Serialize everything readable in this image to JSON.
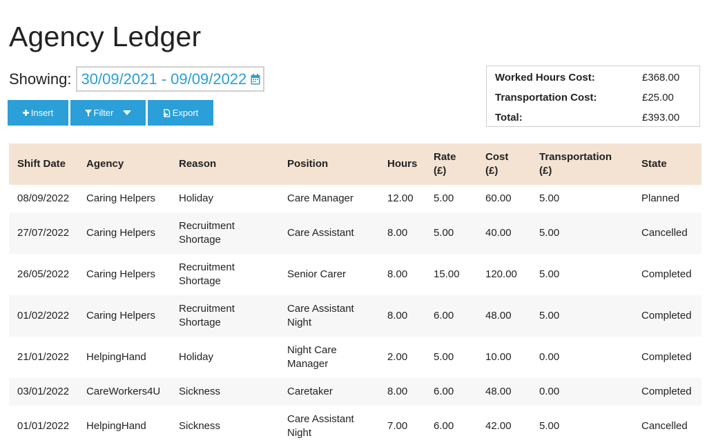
{
  "page": {
    "title": "Agency Ledger",
    "showing_label": "Showing:",
    "date_range": "30/09/2021 - 09/09/2022"
  },
  "toolbar": {
    "insert_label": "Insert",
    "filter_label": "Filter",
    "export_label": "Export"
  },
  "summary": {
    "worked_hours_label": "Worked Hours Cost:",
    "worked_hours_value": "£368.00",
    "transport_label": "Transportation Cost:",
    "transport_value": "£25.00",
    "total_label": "Total:",
    "total_value": "£393.00"
  },
  "table": {
    "headers": {
      "shift_date": "Shift Date",
      "agency": "Agency",
      "reason": "Reason",
      "position": "Position",
      "hours": "Hours",
      "rate_1": "Rate",
      "rate_2": "(£)",
      "cost_1": "Cost",
      "cost_2": "(£)",
      "transport_1": "Transportation",
      "transport_2": "(£)",
      "state": "State"
    },
    "rows": [
      {
        "date": "08/09/2022",
        "agency": "Caring Helpers",
        "reason_1": "Holiday",
        "reason_2": "",
        "position_1": "Care Manager",
        "position_2": "",
        "hours": "12.00",
        "rate": "5.00",
        "cost": "60.00",
        "transport": "5.00",
        "state": "Planned"
      },
      {
        "date": "27/07/2022",
        "agency": "Caring Helpers",
        "reason_1": "Recruitment",
        "reason_2": "Shortage",
        "position_1": "Care Assistant",
        "position_2": "",
        "hours": "8.00",
        "rate": "5.00",
        "cost": "40.00",
        "transport": "5.00",
        "state": "Cancelled"
      },
      {
        "date": "26/05/2022",
        "agency": "Caring Helpers",
        "reason_1": "Recruitment",
        "reason_2": "Shortage",
        "position_1": "Senior Carer",
        "position_2": "",
        "hours": "8.00",
        "rate": "15.00",
        "cost": "120.00",
        "transport": "5.00",
        "state": "Completed"
      },
      {
        "date": "01/02/2022",
        "agency": "Caring Helpers",
        "reason_1": "Recruitment",
        "reason_2": "Shortage",
        "position_1": "Care Assistant",
        "position_2": "Night",
        "hours": "8.00",
        "rate": "6.00",
        "cost": "48.00",
        "transport": "5.00",
        "state": "Completed"
      },
      {
        "date": "21/01/2022",
        "agency": "HelpingHand",
        "reason_1": "Holiday",
        "reason_2": "",
        "position_1": "Night Care",
        "position_2": "Manager",
        "hours": "2.00",
        "rate": "5.00",
        "cost": "10.00",
        "transport": "0.00",
        "state": "Completed"
      },
      {
        "date": "03/01/2022",
        "agency": "CareWorkers4U",
        "reason_1": "Sickness",
        "reason_2": "",
        "position_1": "Caretaker",
        "position_2": "",
        "hours": "8.00",
        "rate": "6.00",
        "cost": "48.00",
        "transport": "0.00",
        "state": "Completed"
      },
      {
        "date": "01/01/2022",
        "agency": "HelpingHand",
        "reason_1": "Sickness",
        "reason_2": "",
        "position_1": "Care Assistant",
        "position_2": "Night",
        "hours": "7.00",
        "rate": "6.00",
        "cost": "42.00",
        "transport": "5.00",
        "state": "Cancelled"
      }
    ]
  },
  "icons": {
    "calendar": "calendar-icon",
    "insert": "plus-icon",
    "filter": "funnel-icon",
    "filter_caret": "caret-down-icon",
    "export": "export-doc-icon"
  },
  "colors": {
    "accent": "#2a9fd8",
    "header_bg": "#f4e3d3",
    "stripe_bg": "#f7f7f7"
  }
}
